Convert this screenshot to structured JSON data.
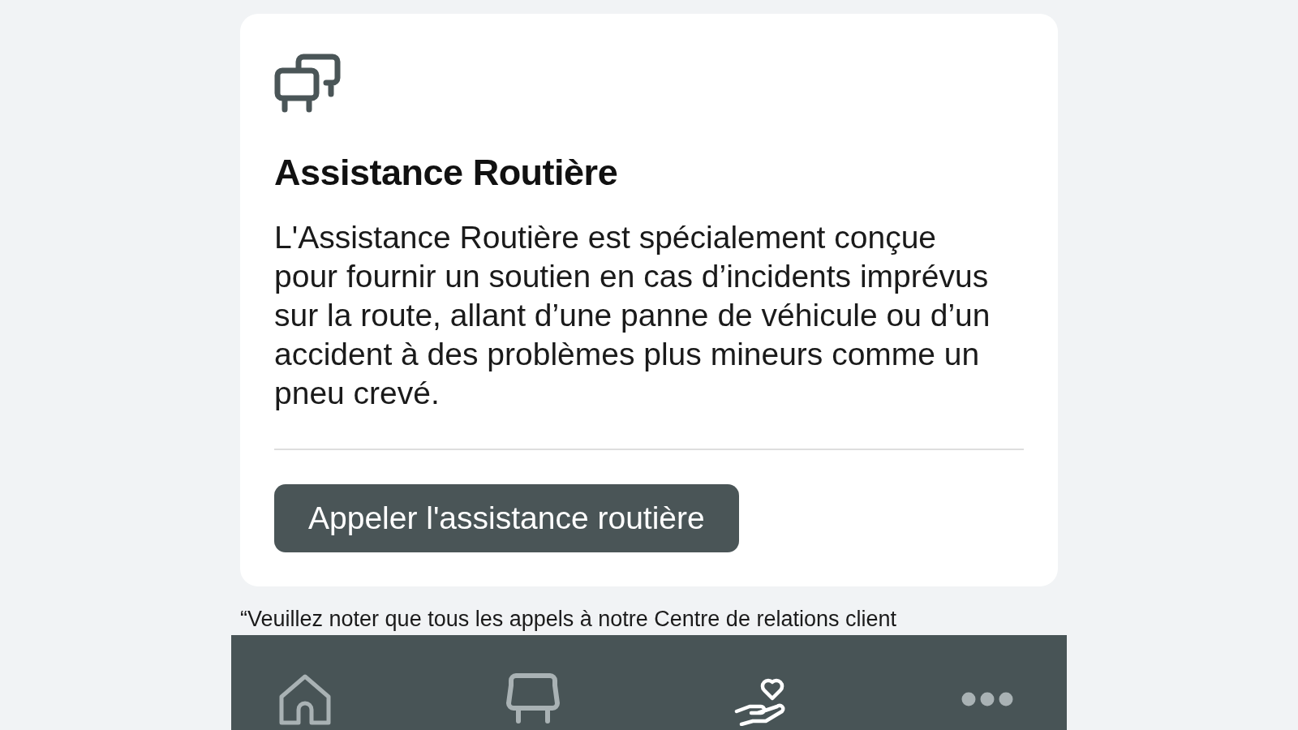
{
  "card": {
    "title": "Assistance Routière",
    "description": "L'Assistance Routière est spécialement conçue pour fournir un soutien en cas d’incidents imprévus sur la route, allant d’une panne de véhicule ou d’un accident à des problèmes plus mineurs comme un pneu crevé.",
    "button": "Appeler l'assistance routière"
  },
  "note": "“Veuillez noter que tous les appels à notre Centre de relations client",
  "nav": {
    "items": [
      {
        "kind": "home",
        "selected": false
      },
      {
        "kind": "car",
        "selected": false
      },
      {
        "kind": "care",
        "selected": true
      },
      {
        "kind": "more",
        "selected": false
      }
    ]
  }
}
